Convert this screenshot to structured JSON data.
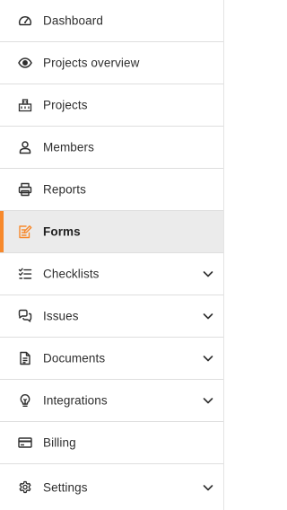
{
  "sidebar": {
    "accent_color": "#f7892c",
    "items": [
      {
        "label": "Dashboard",
        "icon": "gauge-icon"
      },
      {
        "label": "Projects overview",
        "icon": "eye-icon"
      },
      {
        "label": "Projects",
        "icon": "building-icon"
      },
      {
        "label": "Members",
        "icon": "user-icon"
      },
      {
        "label": "Reports",
        "icon": "printer-icon"
      },
      {
        "label": "Forms",
        "icon": "form-edit-icon",
        "active": true
      },
      {
        "label": "Checklists",
        "icon": "checklist-icon",
        "expandable": true
      },
      {
        "label": "Issues",
        "icon": "chat-bubbles-icon",
        "expandable": true
      },
      {
        "label": "Documents",
        "icon": "document-icon",
        "expandable": true
      },
      {
        "label": "Integrations",
        "icon": "lightbulb-icon",
        "expandable": true
      },
      {
        "label": "Billing",
        "icon": "credit-card-icon"
      },
      {
        "label": "Settings",
        "icon": "gear-icon",
        "expandable": true
      }
    ]
  }
}
